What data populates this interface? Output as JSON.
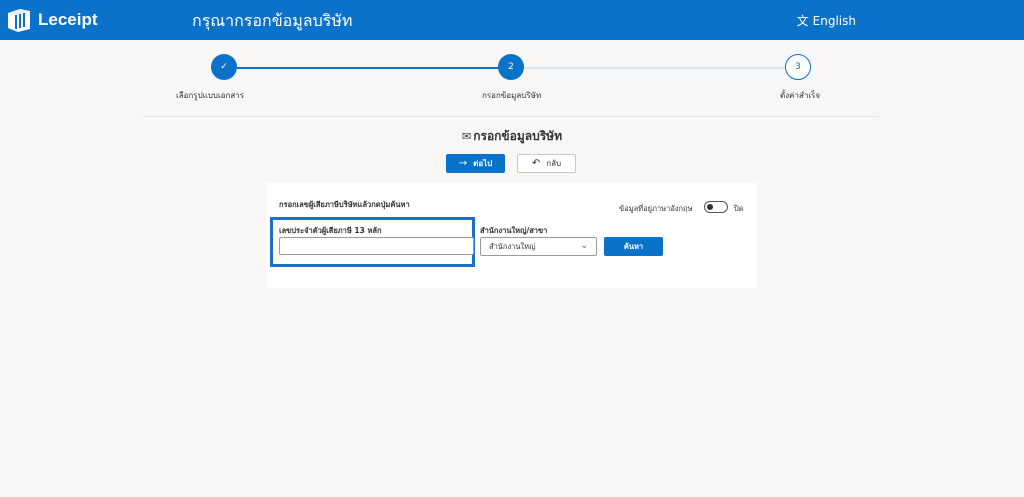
{
  "header": {
    "brand_name": "Leceipt",
    "brand_icon": "receipt-logo-icon",
    "title": "กรุณากรอกข้อมูลบริษัท",
    "language_label": "English",
    "language_icon": "translate-icon",
    "bar_color": "#0a72c9"
  },
  "stepper": {
    "steps": [
      {
        "number": "✓",
        "label": "เลือกรูปแบบเอกสาร",
        "state": "done"
      },
      {
        "number": "2",
        "label": "กรอกข้อมูลบริษัท",
        "state": "current"
      },
      {
        "number": "3",
        "label": "ตั้งค่าสำเร็จ",
        "state": "todo"
      }
    ],
    "accent_color": "#0a72c9"
  },
  "main": {
    "section_title": "กรอกข้อมูลบริษัท",
    "section_icon": "mail-icon",
    "next_button": "ต่อไป",
    "back_button": "กลับ"
  },
  "form": {
    "instruction": "กรอกเลขผู้เสียภาษีบริษัทแล้วกดปุ่มค้นหา",
    "english_toggle_label": "ข้อมูลที่อยู่ภาษาอังกฤษ",
    "english_toggle_state": "ปิด",
    "tax_id_label": "เลขประจำตัวผู้เสียภาษี 13 หลัก",
    "tax_id_value": "",
    "branch_label": "สำนักงานใหญ่/สาขา",
    "branch_selected": "สำนักงานใหญ่",
    "search_button": "ค้นหา"
  }
}
